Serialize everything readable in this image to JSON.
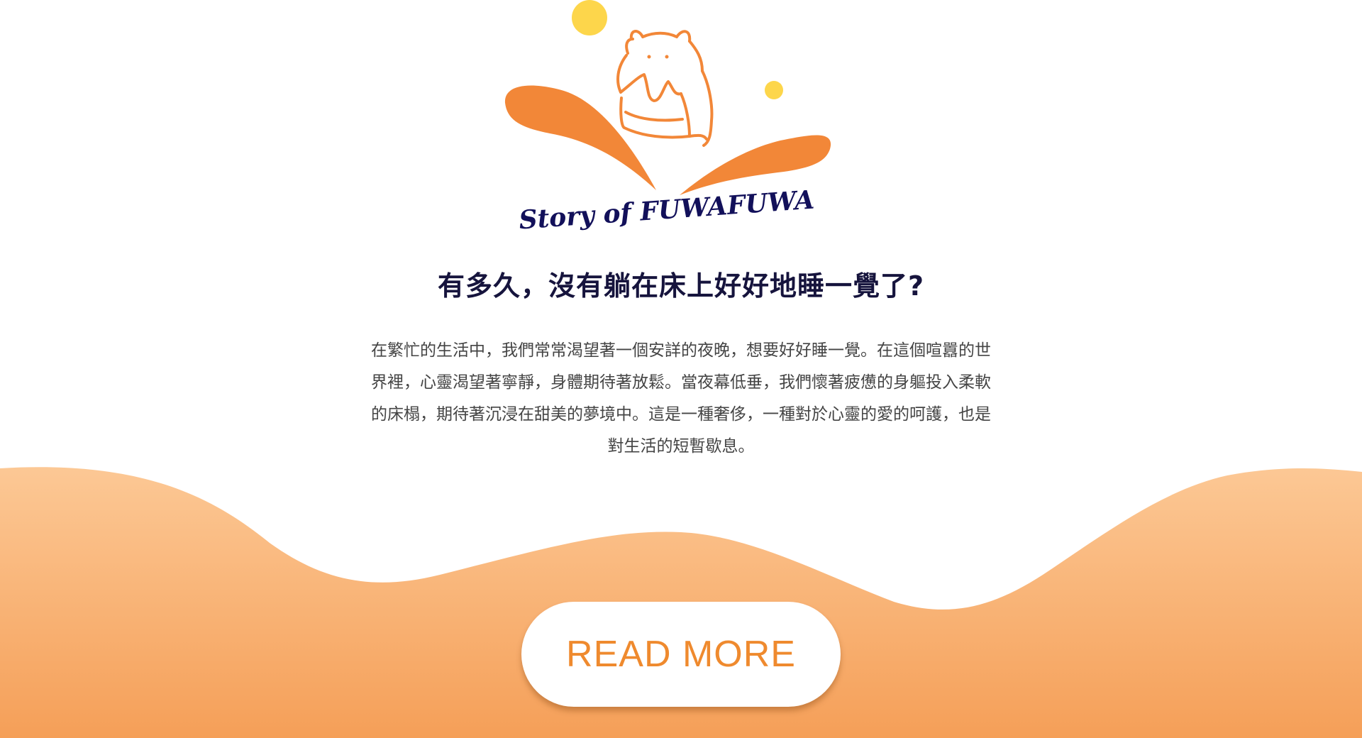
{
  "logo": {
    "text": "Story of FUWAFUWA",
    "icon": "cat-on-pillow-logo-icon",
    "colors": {
      "orange": "#f28738",
      "yellow": "#fdd64b",
      "navy": "#12105a"
    }
  },
  "hero": {
    "headline": "有多久，沒有躺在床上好好地睡一覺了?",
    "body": "在繁忙的生活中，我們常常渴望著一個安詳的夜晚，想要好好睡一覺。在這個喧囂的世界裡，心靈渴望著寧靜，身體期待著放鬆。當夜幕低垂，我們懷著疲憊的身軀投入柔軟的床榻，期待著沉浸在甜美的夢境中。這是一種奢侈，一種對於心靈的愛的呵護，也是對生活的短暫歇息。"
  },
  "cta": {
    "read_more_label": "READ MORE"
  },
  "theme": {
    "wave_top": "#fcc895",
    "wave_bottom": "#f59f58",
    "accent": "#ef8a2e",
    "heading_color": "#16143d",
    "text_color": "#444444"
  }
}
